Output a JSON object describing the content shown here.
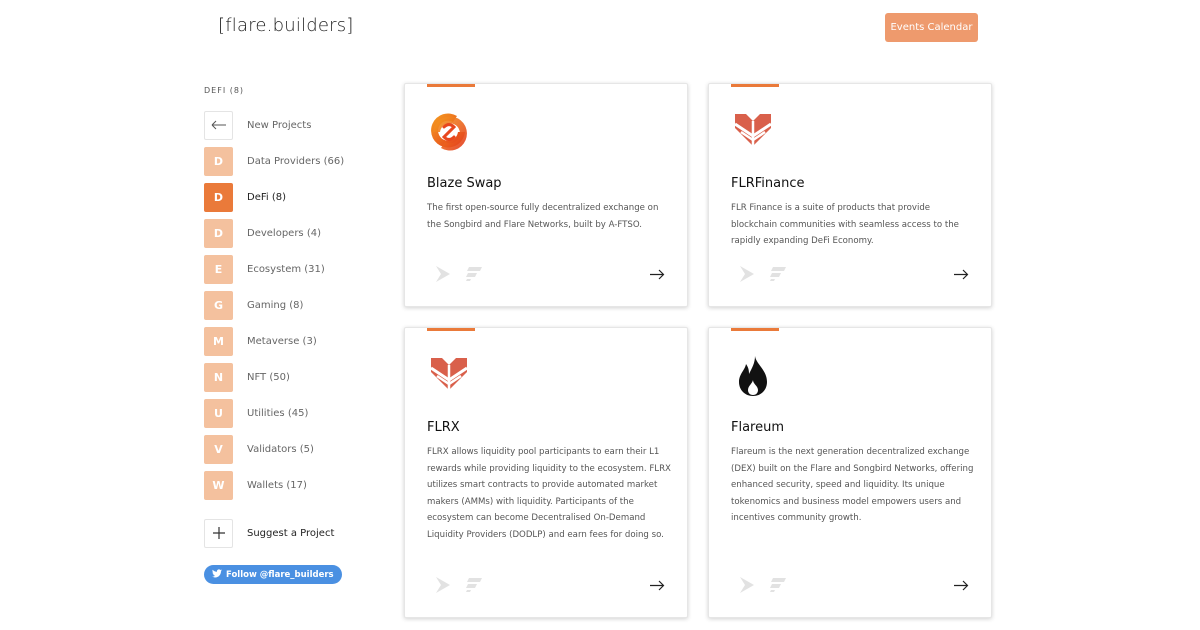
{
  "header": {
    "logo": "[flare.builders]",
    "calendar_button": "Events Calendar"
  },
  "sidebar": {
    "heading": "DEFI (8)",
    "items": [
      {
        "tile": "",
        "label": "New Projects",
        "icon": "arrow-left-icon"
      },
      {
        "tile": "D",
        "label": "Data Providers (66)"
      },
      {
        "tile": "D",
        "label": "DeFi (8)",
        "active": true
      },
      {
        "tile": "D",
        "label": "Developers (4)"
      },
      {
        "tile": "E",
        "label": "Ecosystem (31)"
      },
      {
        "tile": "G",
        "label": "Gaming (8)"
      },
      {
        "tile": "M",
        "label": "Metaverse (3)"
      },
      {
        "tile": "N",
        "label": "NFT (50)"
      },
      {
        "tile": "U",
        "label": "Utilities (45)"
      },
      {
        "tile": "V",
        "label": "Validators (5)"
      },
      {
        "tile": "W",
        "label": "Wallets (17)"
      }
    ],
    "suggest_label": "Suggest a Project",
    "follow_label": "Follow @flare_builders"
  },
  "cards": [
    {
      "title": "Blaze Swap",
      "description": "The first open-source fully decentralized exchange on the Songbird and Flare Networks, built by A-FTSO.",
      "icon": "blaze-swap-logo-icon"
    },
    {
      "title": "FLRFinance",
      "description": "FLR Finance is a suite of products that provide blockchain communities with seamless access to the rapidly expanding DeFi Economy.",
      "icon": "flrfinance-logo-icon"
    },
    {
      "title": "FLRX",
      "description": "FLRX allows liquidity pool participants to earn their L1 rewards while providing liquidity to the ecosystem. FLRX utilizes smart contracts to provide automated market makers (AMMs) with liquidity. Participants of the ecosystem can become Decentralised On-Demand Liquidity Providers (DODLP) and earn fees for doing so.",
      "icon": "flrx-logo-icon"
    },
    {
      "title": "Flareum",
      "description": "Flareum is the next generation decentralized exchange (DEX) built on the Flare and Songbird Networks, offering enhanced security, speed and liquidity. Its unique tokenomics and business model empowers users and incentives community growth.",
      "icon": "flareum-logo-icon"
    }
  ],
  "colors": {
    "accent": "#ea7a3a",
    "tile": "#f4c19e",
    "button": "#ee9a6d",
    "twitter": "#4a90e2"
  }
}
